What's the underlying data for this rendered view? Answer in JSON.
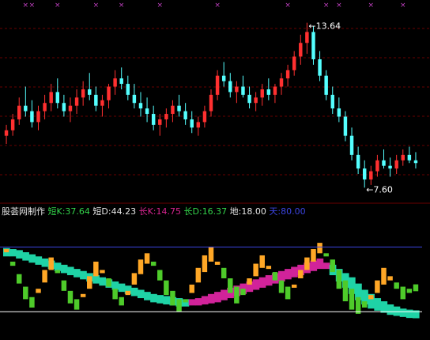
{
  "chart_data": [
    {
      "type": "candlestick",
      "y_ticks": [],
      "annotations": [
        {
          "label": "13.64",
          "kind": "high"
        },
        {
          "label": "7.60",
          "kind": "low"
        }
      ],
      "ohlc": [
        [
          9.5,
          9.9,
          9.2,
          9.7
        ],
        [
          9.7,
          10.3,
          9.5,
          10.1
        ],
        [
          10.1,
          10.9,
          9.9,
          10.6
        ],
        [
          10.6,
          11.3,
          10.2,
          10.4
        ],
        [
          10.4,
          10.8,
          9.8,
          10.0
        ],
        [
          10.0,
          10.6,
          9.7,
          10.4
        ],
        [
          10.4,
          11.0,
          10.1,
          10.7
        ],
        [
          10.7,
          11.4,
          10.4,
          11.1
        ],
        [
          11.1,
          11.6,
          10.5,
          10.7
        ],
        [
          10.7,
          11.0,
          10.2,
          10.4
        ],
        [
          10.4,
          10.9,
          10.0,
          10.6
        ],
        [
          10.6,
          11.2,
          10.3,
          10.9
        ],
        [
          10.9,
          11.5,
          10.6,
          11.2
        ],
        [
          11.2,
          11.8,
          10.8,
          11.0
        ],
        [
          11.0,
          11.3,
          10.4,
          10.6
        ],
        [
          10.6,
          11.0,
          10.2,
          10.8
        ],
        [
          10.8,
          11.4,
          10.5,
          11.3
        ],
        [
          11.3,
          11.9,
          11.0,
          11.6
        ],
        [
          11.6,
          12.0,
          11.2,
          11.4
        ],
        [
          11.4,
          11.7,
          10.8,
          11.0
        ],
        [
          11.0,
          11.4,
          10.5,
          10.7
        ],
        [
          10.7,
          11.1,
          10.2,
          10.5
        ],
        [
          10.5,
          10.9,
          10.0,
          10.3
        ],
        [
          10.3,
          10.6,
          9.7,
          9.9
        ],
        [
          9.9,
          10.3,
          9.5,
          10.1
        ],
        [
          10.1,
          10.5,
          9.8,
          10.3
        ],
        [
          10.3,
          10.8,
          10.0,
          10.6
        ],
        [
          10.6,
          11.0,
          10.2,
          10.4
        ],
        [
          10.4,
          10.7,
          9.9,
          10.1
        ],
        [
          10.1,
          10.4,
          9.6,
          9.8
        ],
        [
          9.8,
          10.2,
          9.5,
          10.0
        ],
        [
          10.0,
          10.6,
          9.8,
          10.4
        ],
        [
          10.4,
          11.2,
          10.2,
          11.0
        ],
        [
          11.0,
          11.9,
          10.8,
          11.7
        ],
        [
          11.7,
          12.2,
          11.3,
          11.5
        ],
        [
          11.5,
          11.8,
          10.9,
          11.1
        ],
        [
          11.1,
          11.5,
          10.7,
          11.3
        ],
        [
          11.3,
          11.7,
          10.9,
          11.0
        ],
        [
          11.0,
          11.3,
          10.5,
          10.7
        ],
        [
          10.7,
          11.1,
          10.4,
          10.9
        ],
        [
          10.9,
          11.4,
          10.6,
          11.2
        ],
        [
          11.2,
          11.6,
          10.8,
          11.0
        ],
        [
          11.0,
          11.4,
          10.7,
          11.3
        ],
        [
          11.3,
          11.8,
          11.0,
          11.6
        ],
        [
          11.6,
          12.1,
          11.3,
          11.9
        ],
        [
          11.9,
          12.6,
          11.7,
          12.4
        ],
        [
          12.4,
          13.2,
          12.1,
          12.9
        ],
        [
          12.9,
          13.64,
          12.5,
          13.3
        ],
        [
          13.3,
          13.5,
          12.1,
          12.3
        ],
        [
          12.3,
          12.6,
          11.5,
          11.7
        ],
        [
          11.7,
          11.9,
          10.8,
          11.0
        ],
        [
          11.0,
          11.3,
          10.3,
          10.5
        ],
        [
          10.5,
          10.9,
          10.0,
          10.2
        ],
        [
          10.2,
          10.4,
          9.3,
          9.5
        ],
        [
          9.5,
          9.8,
          8.6,
          8.8
        ],
        [
          8.8,
          9.1,
          8.1,
          8.3
        ],
        [
          8.3,
          8.6,
          7.6,
          7.9
        ],
        [
          7.9,
          8.4,
          7.7,
          8.2
        ],
        [
          8.2,
          8.8,
          8.0,
          8.6
        ],
        [
          8.6,
          9.0,
          8.3,
          8.4
        ],
        [
          8.4,
          8.7,
          8.0,
          8.3
        ],
        [
          8.3,
          8.8,
          8.1,
          8.6
        ],
        [
          8.6,
          9.0,
          8.4,
          8.8
        ],
        [
          8.8,
          9.1,
          8.5,
          8.6
        ],
        [
          8.6,
          8.9,
          8.3,
          8.5
        ]
      ]
    },
    {
      "type": "indicator",
      "legend": [
        {
          "label": "股荟网制作",
          "color": "#e6e6e6"
        },
        {
          "label": "短K:37.64",
          "color": "#33d24a"
        },
        {
          "label": "短D:44.23",
          "color": "#e6e6e6"
        },
        {
          "label": "长K:14.75",
          "color": "#d6248f"
        },
        {
          "label": "长D:16.37",
          "color": "#33d24a"
        },
        {
          "label": "地:18.00",
          "color": "#e6e6e6"
        },
        {
          "label": "天:80.00",
          "color": "#3b44e0"
        }
      ],
      "levels": [
        {
          "name": "天",
          "value": 80.0,
          "color": "#3b44e0"
        },
        {
          "name": "地",
          "value": 18.0,
          "color": "#ffffff"
        }
      ],
      "short_k": [
        78,
        62,
        45,
        30,
        22,
        40,
        58,
        70,
        55,
        38,
        26,
        20,
        35,
        52,
        66,
        58,
        42,
        30,
        24,
        38,
        55,
        68,
        74,
        62,
        48,
        34,
        24,
        18,
        28,
        44,
        60,
        72,
        80,
        66,
        50,
        36,
        26,
        34,
        50,
        64,
        72,
        62,
        48,
        36,
        30,
        44,
        58,
        70,
        78,
        84,
        72,
        56,
        40,
        28,
        20,
        16,
        22,
        34,
        48,
        60,
        52,
        40,
        30,
        36,
        37.64
      ],
      "short_d": [
        76,
        66,
        54,
        42,
        32,
        36,
        46,
        58,
        58,
        48,
        38,
        30,
        32,
        40,
        52,
        56,
        50,
        40,
        32,
        34,
        44,
        54,
        64,
        66,
        58,
        48,
        38,
        30,
        30,
        36,
        46,
        56,
        66,
        66,
        60,
        50,
        42,
        40,
        44,
        52,
        60,
        62,
        56,
        48,
        42,
        44,
        50,
        58,
        66,
        74,
        74,
        68,
        58,
        48,
        40,
        32,
        28,
        30,
        36,
        44,
        48,
        46,
        42,
        40,
        44.23
      ],
      "long_k": [
        74,
        74,
        72,
        70,
        68,
        66,
        64,
        62,
        60,
        58,
        56,
        54,
        52,
        50,
        48,
        46,
        44,
        42,
        40,
        38,
        36,
        34,
        32,
        30,
        29,
        28,
        27,
        26,
        26,
        27,
        28,
        30,
        32,
        34,
        36,
        38,
        40,
        42,
        44,
        46,
        48,
        50,
        52,
        54,
        56,
        58,
        60,
        62,
        64,
        66,
        62,
        56,
        50,
        44,
        38,
        32,
        28,
        24,
        22,
        20,
        18,
        17,
        16,
        15,
        14.75
      ],
      "long_d": [
        76,
        75,
        74,
        72,
        70,
        68,
        66,
        64,
        62,
        60,
        58,
        56,
        54,
        52,
        50,
        48,
        46,
        44,
        42,
        40,
        38,
        36,
        34,
        32,
        31,
        30,
        29,
        28,
        27,
        27,
        27,
        28,
        29,
        30,
        32,
        34,
        36,
        38,
        40,
        42,
        44,
        46,
        48,
        50,
        52,
        54,
        56,
        58,
        60,
        62,
        62,
        60,
        56,
        52,
        48,
        42,
        36,
        32,
        28,
        25,
        22,
        20,
        18,
        17,
        16.37
      ],
      "ylim": [
        0,
        100
      ]
    }
  ],
  "markers": {
    "top_symbol": "×",
    "top_positions": [
      3,
      4,
      8,
      14,
      18,
      24,
      33,
      44,
      50,
      52,
      57,
      62
    ]
  },
  "colors": {
    "up": "#ff3030",
    "down": "#54ffff",
    "cyan_bar": "#1fd3a6",
    "magenta_bar": "#d1239a",
    "orange_bar": "#ffa726",
    "green_bar": "#4ecb2a",
    "grid": "#8b0000",
    "marker": "#c040c0"
  }
}
